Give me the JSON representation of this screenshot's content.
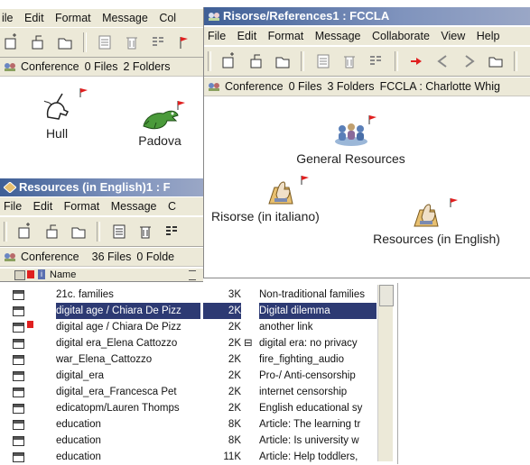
{
  "win1": {
    "menu": [
      "ile",
      "Edit",
      "Format",
      "Message",
      "Col"
    ],
    "status": {
      "name": "Conference",
      "files": "0 Files",
      "folders": "2 Folders"
    },
    "nodes": [
      {
        "label": "Hull",
        "icon": "unicorn-icon"
      },
      {
        "label": "Padova",
        "icon": "dragon-icon"
      }
    ]
  },
  "win2": {
    "title": "Risorse/References1 : FCCLA",
    "menu": [
      "File",
      "Edit",
      "Format",
      "Message",
      "Collaborate",
      "View",
      "Help"
    ],
    "status": {
      "name": "Conference",
      "files": "0 Files",
      "folders": "3 Folders",
      "extra": "FCCLA : Charlotte Whig"
    },
    "nodes": [
      {
        "label": "General Resources",
        "icon": "people-group-icon"
      },
      {
        "label": "Risorse (in italiano)",
        "icon": "hand-folder-icon"
      },
      {
        "label": "Resources (in English)",
        "icon": "hand-folder-icon"
      }
    ]
  },
  "win3": {
    "title": "Resources (in English)1 : F",
    "menu": [
      "File",
      "Edit",
      "Format",
      "Message",
      "C"
    ],
    "status": {
      "name": "Conference",
      "files": "36 Files",
      "folders": "0 Folde"
    },
    "list_header": {
      "name": "Name"
    },
    "rows": [
      {
        "name": "21c. families",
        "size": "3K",
        "stat": "",
        "desc": "Non-traditional families",
        "flag": false,
        "selected": false
      },
      {
        "name": "digital age / Chiara De Pizz",
        "size": "2K",
        "stat": "",
        "desc": "Digital dilemma",
        "flag": false,
        "selected": true
      },
      {
        "name": "digital age / Chiara De Pizz",
        "size": "2K",
        "stat": "",
        "desc": "another link",
        "flag": true,
        "selected": false
      },
      {
        "name": "digital era_Elena Cattozzo",
        "size": "2K",
        "stat": "⊟",
        "desc": "digital era: no privacy",
        "flag": false,
        "selected": false
      },
      {
        "name": "war_Elena_Cattozzo",
        "size": "2K",
        "stat": "",
        "desc": "   fire_fighting_audio",
        "flag": false,
        "selected": false
      },
      {
        "name": "digital_era",
        "size": "2K",
        "stat": "",
        "desc": "Pro-/ Anti-censorship",
        "flag": false,
        "selected": false
      },
      {
        "name": "digital_era_Francesca Pet",
        "size": "2K",
        "stat": "",
        "desc": "internet censorship",
        "flag": false,
        "selected": false
      },
      {
        "name": "edicatopm/Lauren Thomps",
        "size": "2K",
        "stat": "",
        "desc": "English educational sy",
        "flag": false,
        "selected": false
      },
      {
        "name": "education",
        "size": "8K",
        "stat": "",
        "desc": "Article: The learning tr",
        "flag": false,
        "selected": false
      },
      {
        "name": "education",
        "size": "8K",
        "stat": "",
        "desc": "Article: Is university w",
        "flag": false,
        "selected": false
      },
      {
        "name": "education",
        "size": "11K",
        "stat": "",
        "desc": "Article: Help toddlers,",
        "flag": false,
        "selected": false
      }
    ]
  },
  "colors": {
    "flag": "#e02020",
    "selection": "#2d3a73",
    "title_gradient_start": "#3f5f96"
  }
}
